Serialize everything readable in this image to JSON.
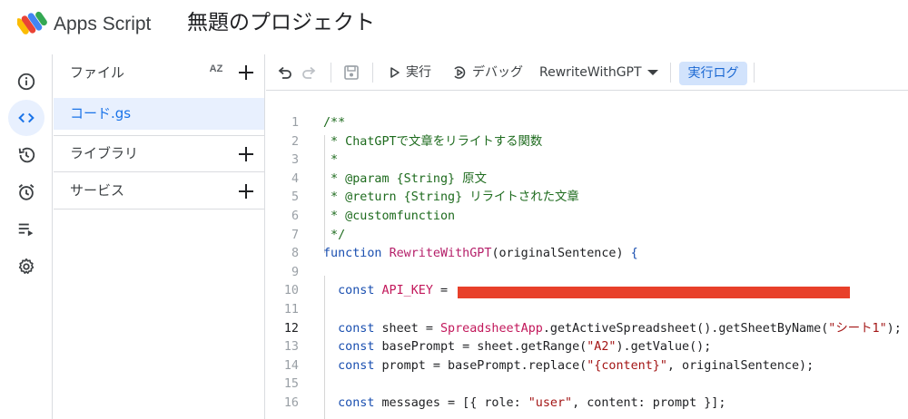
{
  "header": {
    "app_name": "Apps Script",
    "project_title": "無題のプロジェクト"
  },
  "rail": {
    "items": [
      {
        "icon": "info-icon",
        "active": false
      },
      {
        "icon": "code-icon",
        "active": true
      },
      {
        "icon": "history-icon",
        "active": false
      },
      {
        "icon": "alarm-icon",
        "active": false
      },
      {
        "icon": "executions-icon",
        "active": false
      },
      {
        "icon": "gear-icon",
        "active": false
      }
    ]
  },
  "files": {
    "title": "ファイル",
    "sort_label": "AZ",
    "items": [
      {
        "name": "コード.gs",
        "selected": true
      }
    ],
    "libraries_label": "ライブラリ",
    "services_label": "サービス"
  },
  "toolbar": {
    "run_label": "実行",
    "debug_label": "デバッグ",
    "function_select": "RewriteWithGPT",
    "log_label": "実行ログ"
  },
  "editor": {
    "current_line": 12,
    "lines": [
      {
        "n": "1",
        "tokens": [
          [
            "cmt",
            "/**"
          ]
        ]
      },
      {
        "n": "2",
        "tokens": [
          [
            "cmt",
            " * ChatGPTで文章をリライトする関数"
          ]
        ]
      },
      {
        "n": "3",
        "tokens": [
          [
            "cmt",
            " *"
          ]
        ]
      },
      {
        "n": "4",
        "tokens": [
          [
            "cmt",
            " * @param {String} 原文"
          ]
        ]
      },
      {
        "n": "5",
        "tokens": [
          [
            "cmt",
            " * @return {String} リライトされた文章"
          ]
        ]
      },
      {
        "n": "6",
        "tokens": [
          [
            "cmt",
            " * @customfunction"
          ]
        ]
      },
      {
        "n": "7",
        "tokens": [
          [
            "cmt",
            " */"
          ]
        ]
      },
      {
        "n": "8",
        "tokens": [
          [
            "kw",
            "function "
          ],
          [
            "fn",
            "RewriteWithGPT"
          ],
          [
            "var",
            "(originalSentence) "
          ],
          [
            "kw",
            "{"
          ]
        ]
      },
      {
        "n": "9",
        "tokens": []
      },
      {
        "n": "10",
        "tokens": [
          [
            "var",
            "  "
          ],
          [
            "kw",
            "const "
          ],
          [
            "cls",
            "API_KEY"
          ],
          [
            "var",
            " = "
          ]
        ]
      },
      {
        "n": "11",
        "tokens": []
      },
      {
        "n": "12",
        "tokens": [
          [
            "var",
            "  "
          ],
          [
            "kw",
            "const "
          ],
          [
            "var",
            "sheet = "
          ],
          [
            "cls",
            "SpreadsheetApp"
          ],
          [
            "var",
            ".getActiveSpreadsheet().getSheetByName("
          ],
          [
            "str",
            "\"シート1\""
          ],
          [
            "var",
            ");"
          ]
        ]
      },
      {
        "n": "13",
        "tokens": [
          [
            "var",
            "  "
          ],
          [
            "kw",
            "const "
          ],
          [
            "var",
            "basePrompt = sheet.getRange("
          ],
          [
            "str",
            "\"A2\""
          ],
          [
            "var",
            ").getValue();"
          ]
        ]
      },
      {
        "n": "14",
        "tokens": [
          [
            "var",
            "  "
          ],
          [
            "kw",
            "const "
          ],
          [
            "var",
            "prompt = basePrompt.replace("
          ],
          [
            "str",
            "\"{content}\""
          ],
          [
            "var",
            ", originalSentence);"
          ]
        ]
      },
      {
        "n": "15",
        "tokens": []
      },
      {
        "n": "16",
        "tokens": [
          [
            "var",
            "  "
          ],
          [
            "kw",
            "const "
          ],
          [
            "var",
            "messages = [{ role: "
          ],
          [
            "str",
            "\"user\""
          ],
          [
            "var",
            ", content: prompt }];"
          ]
        ]
      }
    ]
  },
  "colors": {
    "accent": "#1a73e8",
    "active_bg": "#e8f0fe",
    "log_button_bg": "#d2e3fc",
    "redaction": "#e8402a"
  }
}
